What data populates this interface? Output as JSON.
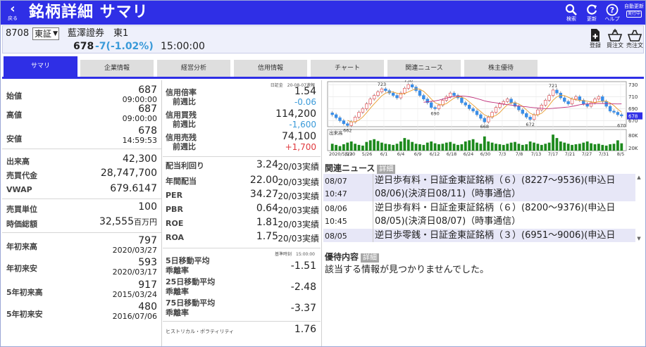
{
  "header": {
    "back_label": "戻る",
    "title": "銘柄詳細 サマリ",
    "search_label": "検索",
    "refresh_label": "更新",
    "help_label": "ヘルプ",
    "auto_label": "自動更新",
    "auto_state": "実行中"
  },
  "stock": {
    "code": "8708",
    "market": "東証",
    "name": "藍澤證券",
    "section": "東1",
    "price": "678",
    "change": "-7(-1.02%)",
    "time": "15:00:00",
    "register_label": "登録",
    "buy_label": "買注文",
    "sell_label": "売注文"
  },
  "tabs": [
    "サマリ",
    "企業情報",
    "経営分析",
    "信用情報",
    "チャート",
    "関連ニュース",
    "株主優待"
  ],
  "col1": {
    "open": {
      "label": "始値",
      "value": "687",
      "time": "09:00:00"
    },
    "high": {
      "label": "高値",
      "value": "687",
      "time": "09:00:00"
    },
    "low": {
      "label": "安値",
      "value": "678",
      "time": "14:59:53"
    },
    "volume": {
      "label": "出来高",
      "value": "42,300"
    },
    "turnover": {
      "label": "売買代金",
      "value": "28,747,700"
    },
    "vwap": {
      "label": "VWAP",
      "value": "679.6147"
    },
    "unit": {
      "label": "売買単位",
      "value": "100"
    },
    "mcap": {
      "label": "時価総額",
      "value": "32,555",
      "suffix": "百万円"
    },
    "ytd_high": {
      "label": "年初来高",
      "value": "797",
      "date": "2020/03/27"
    },
    "ytd_low": {
      "label": "年初来安",
      "value": "593",
      "date": "2020/03/17"
    },
    "y5_high": {
      "label": "5年初来高",
      "value": "917",
      "date": "2015/03/24"
    },
    "y5_low": {
      "label": "5年初来安",
      "value": "480",
      "date": "2016/07/06"
    }
  },
  "col2": {
    "margin_note": "日証金　20-08-07速報",
    "margin_ratio": {
      "label": "信用倍率",
      "sub": "前週比",
      "value": "1.54",
      "diff": "-0.06"
    },
    "margin_buy": {
      "label": "信用買残",
      "sub": "前週比",
      "value": "114,200",
      "diff": "-1,600"
    },
    "margin_sell": {
      "label": "信用売残",
      "sub": "前週比",
      "value": "74,100",
      "diff": "+1,700"
    },
    "dividend_yield": {
      "label": "配当利回り",
      "value": "3.24",
      "unit": "20/03実績"
    },
    "annual_div": {
      "label": "年間配当",
      "value": "22.00",
      "unit": "20/03実績"
    },
    "per": {
      "label": "PER",
      "value": "34.27",
      "unit": "20/03実績"
    },
    "pbr": {
      "label": "PBR",
      "value": "0.64",
      "unit": "20/03実績"
    },
    "roe": {
      "label": "ROE",
      "value": "1.81",
      "unit": "20/03実績"
    },
    "roa": {
      "label": "ROA",
      "value": "1.75",
      "unit": "20/03実績"
    },
    "ma_note": "基準時刻　15:00:00",
    "ma5": {
      "label1": "5日移動平均",
      "label2": "乖離率",
      "value": "-1.51"
    },
    "ma25": {
      "label1": "25日移動平均",
      "label2": "乖離率",
      "value": "-2.48"
    },
    "ma75": {
      "label1": "75日移動平均",
      "label2": "乖離率",
      "value": "-3.37"
    },
    "hv": {
      "label": "ヒストリカル・ボラティリティ",
      "value": "1.76"
    }
  },
  "chart_data": {
    "type": "candlestick",
    "x_ticks": [
      "2020/5/13",
      "5/20",
      "5/26",
      "6/1",
      "6/4",
      "6/9",
      "6/12",
      "6/18",
      "6/24",
      "6/30",
      "7/3",
      "7/8",
      "7/13",
      "7/17",
      "7/21",
      "7/27",
      "7/31",
      "8/5"
    ],
    "price_axis": [
      "730",
      "710",
      "690",
      "670"
    ],
    "price_range": [
      660,
      735
    ],
    "price_labels": [
      "723",
      "730",
      "690",
      "662",
      "668",
      "672",
      "721",
      "670"
    ],
    "current_price": "678",
    "volume_label": "出来高",
    "volume_axis": [
      "80K",
      "20K"
    ],
    "closes": [
      680,
      675,
      670,
      665,
      662,
      668,
      676,
      684,
      690,
      698,
      706,
      712,
      718,
      723,
      720,
      716,
      712,
      708,
      716,
      724,
      730,
      726,
      720,
      712,
      706,
      700,
      692,
      690,
      696,
      704,
      710,
      716,
      712,
      708,
      700,
      696,
      690,
      686,
      680,
      674,
      668,
      676,
      684,
      692,
      698,
      702,
      706,
      700,
      694,
      688,
      682,
      676,
      672,
      680,
      688,
      696,
      704,
      712,
      721,
      716,
      708,
      702,
      698,
      706,
      710,
      704,
      698,
      694,
      700,
      706,
      710,
      702,
      694,
      686,
      684,
      680,
      678
    ],
    "volumes": [
      30,
      25,
      20,
      28,
      35,
      40,
      30,
      25,
      22,
      38,
      45,
      50,
      42,
      35,
      30,
      28,
      25,
      30,
      40,
      55,
      48,
      38,
      30,
      28,
      25,
      35,
      40,
      32,
      28,
      30,
      35,
      38,
      30,
      25,
      28,
      40,
      45,
      50,
      35,
      30,
      62,
      40,
      35,
      30,
      28,
      25,
      30,
      35,
      38,
      30,
      25,
      28,
      40,
      35,
      30,
      25,
      30,
      35,
      70,
      55,
      40,
      35,
      30,
      25,
      28,
      30,
      35,
      40,
      32,
      28,
      30,
      25,
      22,
      28,
      30,
      45,
      32
    ]
  },
  "news": {
    "heading": "関連ニュース",
    "more_label": "詳細",
    "items": [
      {
        "date": "08/07",
        "time": "10:47",
        "line1": "逆日歩有料・日証金東証銘柄（６）(8227〜9536)(申込日",
        "line2": "08/06)(決済日08/11)（時事通信）"
      },
      {
        "date": "08/06",
        "time": "10:45",
        "line1": "逆日歩有料・日証金東証銘柄（６）(8200〜9376)(申込日",
        "line2": "08/05)(決済日08/07)（時事通信）"
      },
      {
        "date": "08/05",
        "time": "",
        "line1": "逆日歩零銭・日証金東証銘柄（３）(6951〜9006)(申込日",
        "line2": ""
      }
    ]
  },
  "yutai": {
    "heading": "優待内容",
    "more_label": "詳細",
    "text": "該当する情報が見つかりませんでした。"
  }
}
